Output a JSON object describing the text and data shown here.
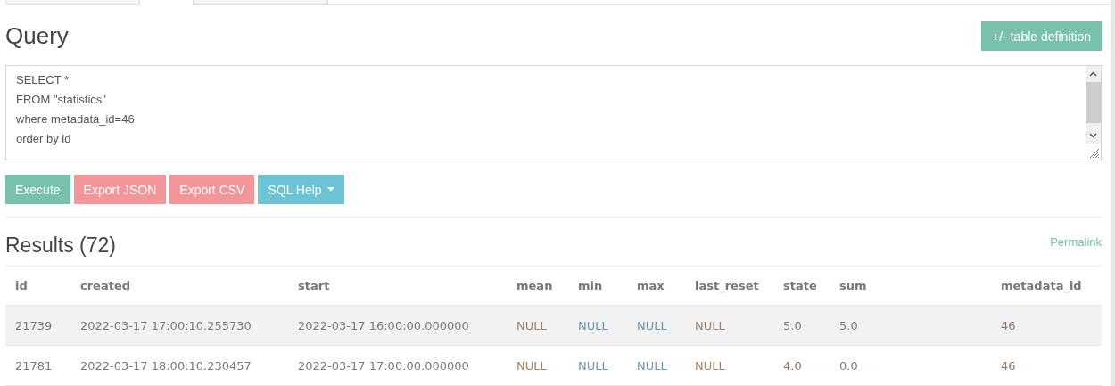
{
  "tabs": [
    {
      "selected": false
    },
    {
      "selected": true
    },
    {
      "selected": false
    }
  ],
  "query": {
    "title": "Query",
    "table_definition_button": "+/- table definition",
    "sql": "SELECT *\nFROM \"statistics\"\nwhere metadata_id=46\norder by id"
  },
  "buttons": [
    {
      "label": "Execute",
      "kind": "success"
    },
    {
      "label": "Export JSON",
      "kind": "danger"
    },
    {
      "label": "Export CSV",
      "kind": "danger"
    },
    {
      "label": "SQL Help",
      "kind": "dropdown"
    }
  ],
  "results": {
    "title": "Results (72)",
    "permalink": "Permalink",
    "columns": [
      {
        "name": "id",
        "color": "#7a7a7a"
      },
      {
        "name": "created",
        "color": "#7a7a7a"
      },
      {
        "name": "start",
        "color": "#7a7a7a"
      },
      {
        "name": "mean",
        "color": "#a0826a"
      },
      {
        "name": "min",
        "color": "#6f93b3"
      },
      {
        "name": "max",
        "color": "#6f93b3"
      },
      {
        "name": "last_reset",
        "color": "#a0826a"
      },
      {
        "name": "state",
        "color": "#8a7a6a"
      },
      {
        "name": "sum",
        "color": "#8a7a6a"
      },
      {
        "name": "metadata_id",
        "color": "#8a7a6a"
      }
    ],
    "rows": [
      [
        "21739",
        "2022-03-17 17:00:10.255730",
        "2022-03-17 16:00:00.000000",
        "NULL",
        "NULL",
        "NULL",
        "NULL",
        "5.0",
        "5.0",
        "46"
      ],
      [
        "21781",
        "2022-03-17 18:00:10.230457",
        "2022-03-17 17:00:00.000000",
        "NULL",
        "NULL",
        "NULL",
        "NULL",
        "4.0",
        "0.0",
        "46"
      ]
    ]
  }
}
